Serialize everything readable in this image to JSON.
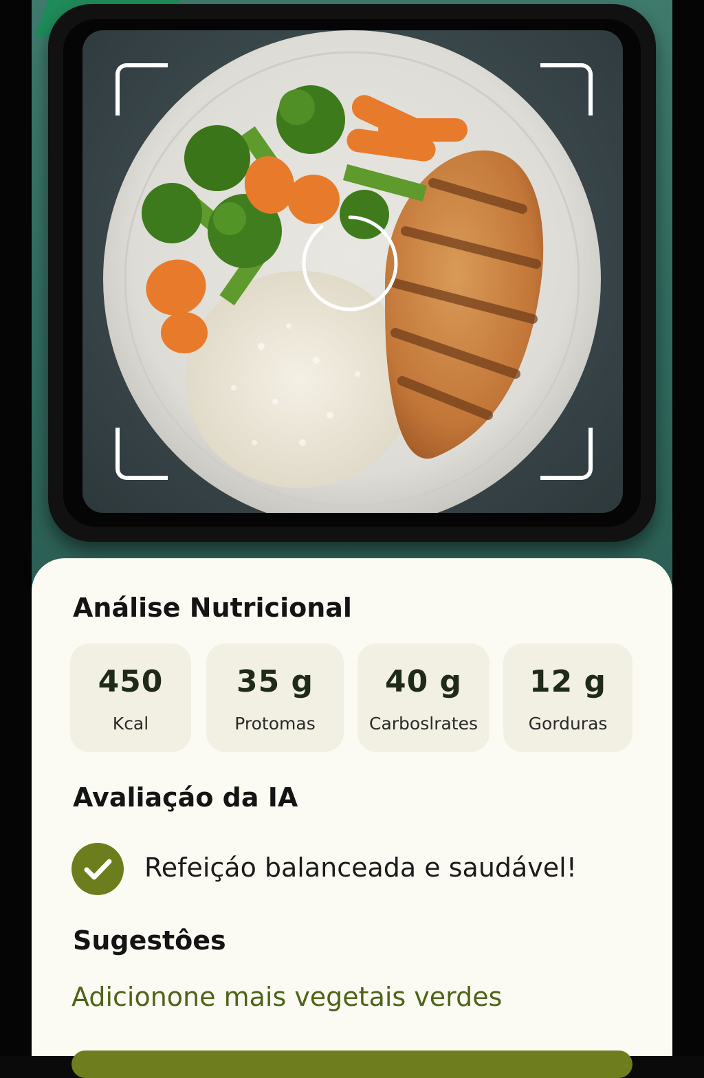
{
  "analysis": {
    "title": "Análise Nutricional",
    "stats": [
      {
        "value": "450",
        "label": "Kcal"
      },
      {
        "value": "35 g",
        "label": "Protomas"
      },
      {
        "value": "40 g",
        "label": "Carboslrates"
      },
      {
        "value": "12 g",
        "label": "Gorduras"
      }
    ]
  },
  "evaluation": {
    "title": "Avaliaçáo da IA",
    "result": "Refeiçáo balanceada e saudável!"
  },
  "suggestions": {
    "title": "Sugestôes",
    "items": [
      "Adicionone mais vegetais verdes"
    ]
  },
  "colors": {
    "accent": "#6b7d1c",
    "suggestion_text": "#4d6418",
    "background_teal": "#3f7a6d"
  },
  "icons": {
    "check": "check-icon",
    "scan_corners": "viewfinder-corner-icon",
    "focus": "focus-ring-icon"
  }
}
